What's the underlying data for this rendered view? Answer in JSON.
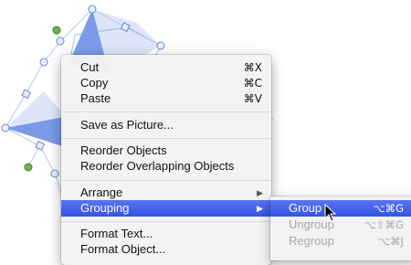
{
  "colors": {
    "highlight": "#3c5ce8",
    "shape_fill": "#6b8fe6",
    "handle_blue": "#cfe0ff",
    "handle_green": "#6fb04f"
  },
  "menu": {
    "items": [
      {
        "label": "Cut",
        "shortcut": "⌘X"
      },
      {
        "label": "Copy",
        "shortcut": "⌘C"
      },
      {
        "label": "Paste",
        "shortcut": "⌘V"
      },
      {
        "label": "Save as Picture..."
      },
      {
        "label": "Reorder Objects"
      },
      {
        "label": "Reorder Overlapping Objects"
      },
      {
        "label": "Arrange"
      },
      {
        "label": "Grouping"
      },
      {
        "label": "Format Text..."
      },
      {
        "label": "Format Object..."
      }
    ]
  },
  "submenu": {
    "items": [
      {
        "label": "Group",
        "shortcut": "⌥⌘G",
        "state": "highlighted"
      },
      {
        "label": "Ungroup",
        "shortcut": "⌥⇧⌘G",
        "state": "disabled"
      },
      {
        "label": "Regroup",
        "shortcut": "⌥⌘J",
        "state": "disabled"
      }
    ]
  },
  "icons": {
    "submenu_arrow": "triangle-right-icon",
    "cursor": "arrow-pointer-icon"
  }
}
